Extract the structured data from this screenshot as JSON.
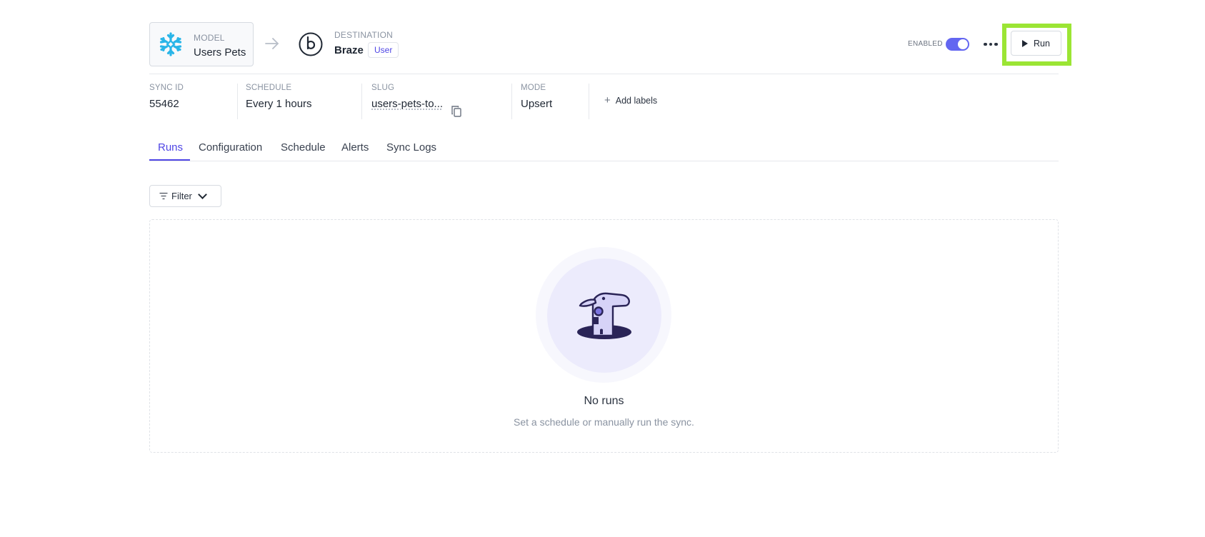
{
  "model": {
    "label": "MODEL",
    "name": "Users Pets",
    "logo_icon": "snowflake-icon"
  },
  "destination": {
    "label": "DESTINATION",
    "name": "Braze",
    "badge": "User",
    "logo_icon": "braze-icon"
  },
  "controls": {
    "enabled_label": "ENABLED",
    "enabled": true,
    "run_label": "Run"
  },
  "info": {
    "sync_id": {
      "label": "SYNC ID",
      "value": "55462"
    },
    "schedule": {
      "label": "SCHEDULE",
      "value": "Every 1 hours"
    },
    "slug": {
      "label": "SLUG",
      "value": "users-pets-to..."
    },
    "mode": {
      "label": "MODE",
      "value": "Upsert"
    },
    "add_labels": "Add labels"
  },
  "tabs": [
    {
      "label": "Runs",
      "active": true
    },
    {
      "label": "Configuration"
    },
    {
      "label": "Schedule"
    },
    {
      "label": "Alerts"
    },
    {
      "label": "Sync Logs"
    }
  ],
  "filter": {
    "label": "Filter"
  },
  "empty": {
    "title": "No runs",
    "subtitle": "Set a schedule or manually run the sync."
  },
  "colors": {
    "accent": "#4f46e5",
    "toggle": "#6366f1",
    "highlight": "#9be534",
    "snowflake": "#29b5e8"
  }
}
